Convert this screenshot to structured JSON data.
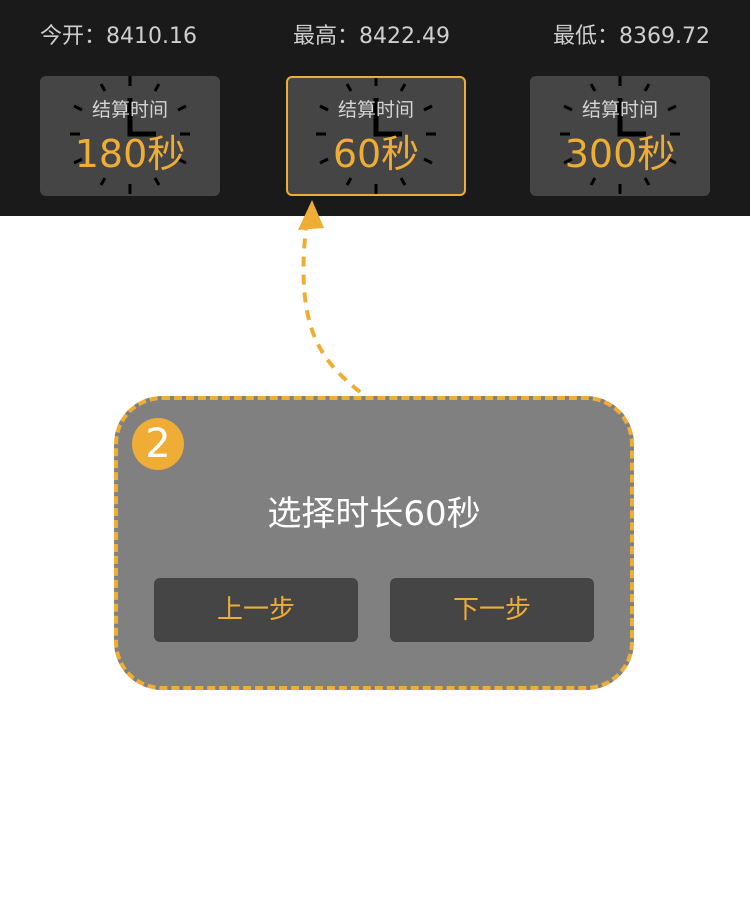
{
  "stats": {
    "open": "今开：8410.16",
    "high": "最高：8422.49",
    "low": "最低：8369.72"
  },
  "settlement_options": [
    {
      "label": "结算时间",
      "value": "180秒",
      "selected": false,
      "icon": "clock-icon"
    },
    {
      "label": "结算时间",
      "value": "60秒",
      "selected": true,
      "icon": "clock-icon"
    },
    {
      "label": "结算时间",
      "value": "300秒",
      "selected": false,
      "icon": "clock-icon"
    }
  ],
  "guide": {
    "step": "2",
    "title": "选择时长60秒",
    "prev_label": "上一步",
    "next_label": "下一步"
  },
  "colors": {
    "accent": "#f0ad35",
    "topbar_bg": "#1a1a1a",
    "card_bg": "#454545",
    "guide_bg": "#808080"
  }
}
